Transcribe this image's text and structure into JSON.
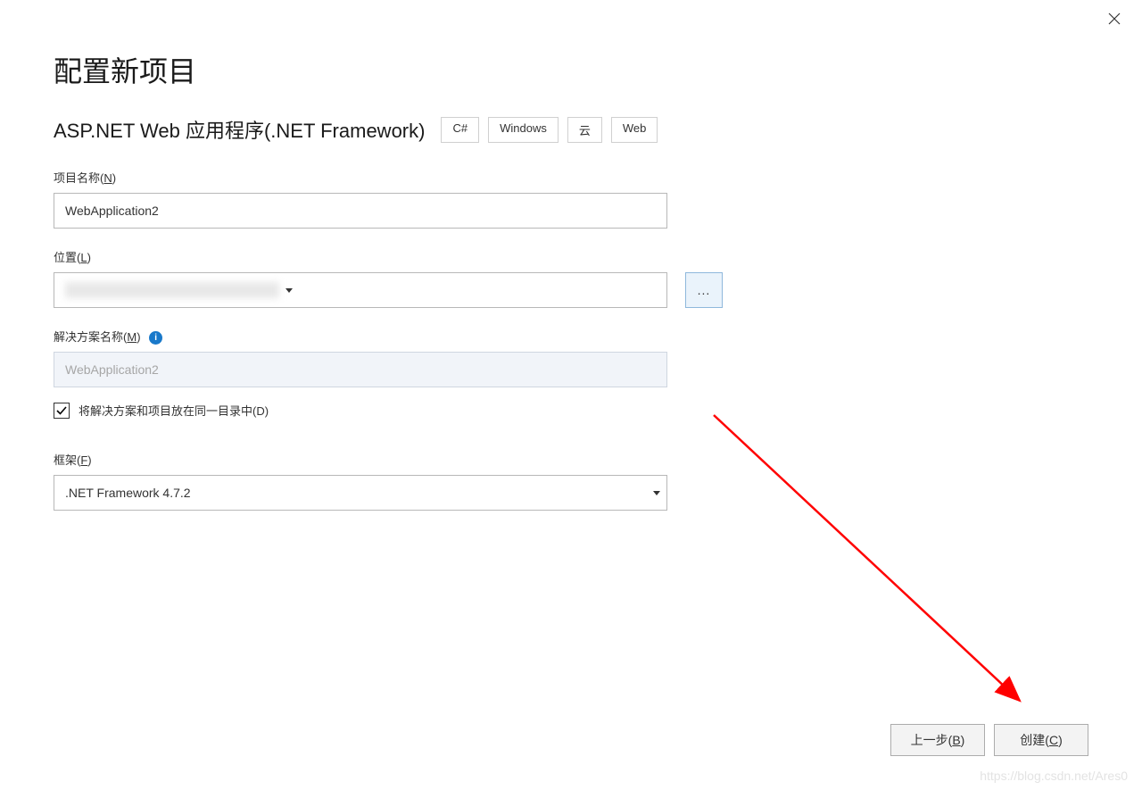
{
  "dialog": {
    "title": "配置新项目",
    "subtitle": "ASP.NET Web 应用程序(.NET Framework)",
    "tags": [
      "C#",
      "Windows",
      "云",
      "Web"
    ]
  },
  "projectName": {
    "labelPrefix": "项目名称(",
    "labelHotkey": "N",
    "labelSuffix": ")",
    "value": "WebApplication2"
  },
  "location": {
    "labelPrefix": "位置(",
    "labelHotkey": "L",
    "labelSuffix": ")",
    "browseLabel": "..."
  },
  "solutionName": {
    "labelPrefix": "解决方案名称(",
    "labelHotkey": "M",
    "labelSuffix": ")",
    "value": "WebApplication2",
    "infoIcon": "i"
  },
  "checkbox": {
    "checked": true,
    "labelPrefix": "将解决方案和项目放在同一目录中(",
    "labelHotkey": "D",
    "labelSuffix": ")"
  },
  "framework": {
    "labelPrefix": "框架(",
    "labelHotkey": "F",
    "labelSuffix": ")",
    "value": ".NET Framework 4.7.2"
  },
  "buttons": {
    "backPrefix": "上一步(",
    "backHotkey": "B",
    "backSuffix": ")",
    "createPrefix": "创建(",
    "createHotkey": "C",
    "createSuffix": ")"
  },
  "watermark": "https://blog.csdn.net/Ares0"
}
